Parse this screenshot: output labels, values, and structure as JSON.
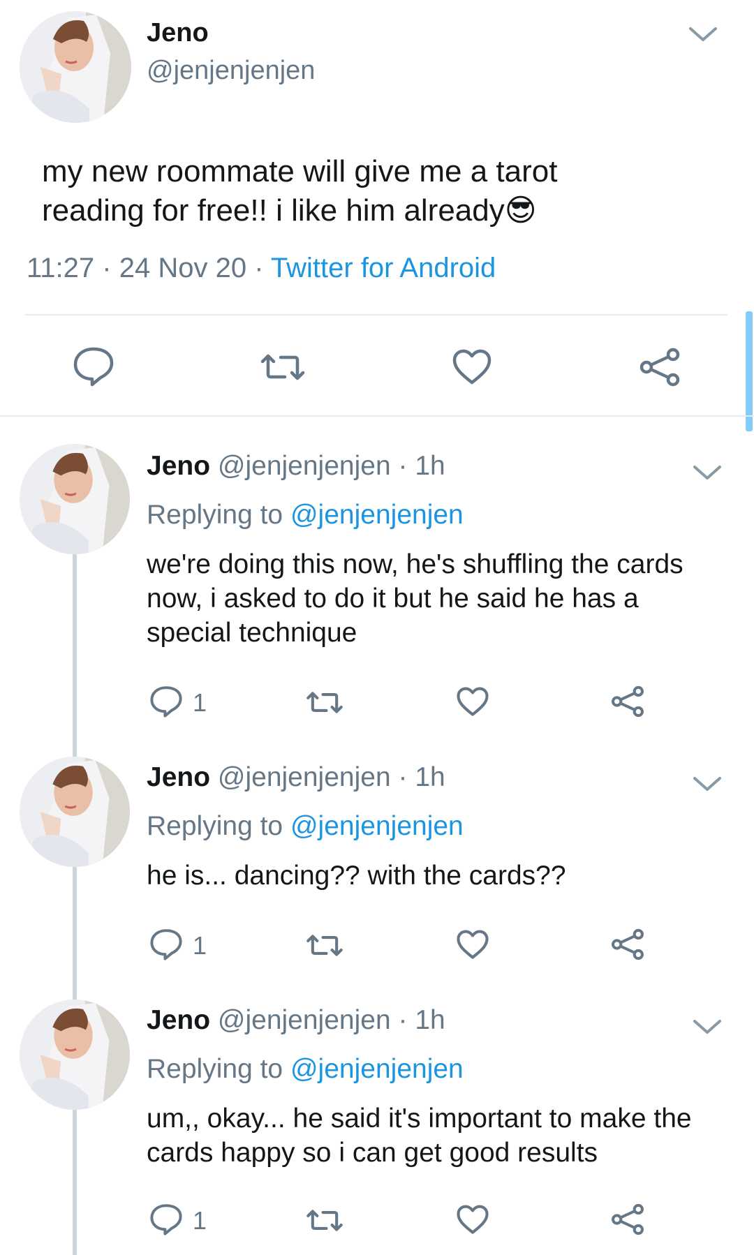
{
  "colors": {
    "accent": "#1b95e0",
    "muted": "#657786",
    "text": "#14171a",
    "divider": "#e6ecf0",
    "thread": "#ccd6dd"
  },
  "main_tweet": {
    "display_name": "Jeno",
    "handle": "@jenjenjenjen",
    "text_line1": "my new roommate will give me a tarot",
    "text_line2": "reading for free!! i like him already",
    "emoji": "😎",
    "time": "11:27",
    "sep1": "·",
    "date": "24 Nov 20",
    "sep2": "·",
    "source": "Twitter for Android",
    "icons": [
      "reply-icon",
      "retweet-icon",
      "like-icon",
      "share-icon"
    ]
  },
  "replies": [
    {
      "display_name": "Jeno",
      "handle": "@jenjenjenjen",
      "time": "· 1h",
      "replying_prefix": "Replying to",
      "replying_handle": "@jenjenjenjen",
      "lines": [
        "we're doing this now, he's shuffling the cards",
        "now, i asked to do it but he said he has a",
        "special technique"
      ],
      "reply_count": "1"
    },
    {
      "display_name": "Jeno",
      "handle": "@jenjenjenjen",
      "time": "· 1h",
      "replying_prefix": "Replying to",
      "replying_handle": "@jenjenjenjen",
      "lines": [
        "he is... dancing?? with the cards??"
      ],
      "reply_count": "1"
    },
    {
      "display_name": "Jeno",
      "handle": "@jenjenjenjen",
      "time": "· 1h",
      "replying_prefix": "Replying to",
      "replying_handle": "@jenjenjenjen",
      "lines": [
        "um,, okay... he said it's important to make the",
        "cards happy so i can get good results"
      ],
      "reply_count": "1"
    }
  ]
}
